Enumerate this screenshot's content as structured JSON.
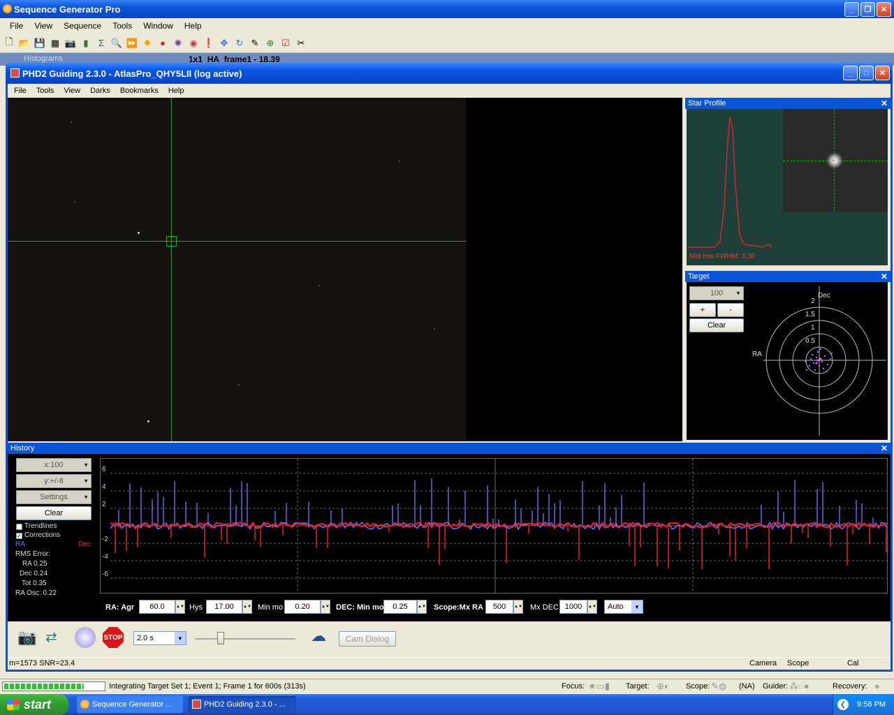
{
  "sgp": {
    "title": "Sequence Generator Pro",
    "menu": [
      "File",
      "View",
      "Sequence",
      "Tools",
      "Window",
      "Help"
    ],
    "behind_tab": "Histograms",
    "behind_doc": "1x1_HA_frame1 - 18.39"
  },
  "phd": {
    "title": "PHD2 Guiding 2.3.0 - AtlasPro_QHY5LII (log active)",
    "menu": [
      "File",
      "Tools",
      "View",
      "Darks",
      "Bookmarks",
      "Help"
    ],
    "star_profile": {
      "title": "Star Profile",
      "fwhm_label": "Mid row  FWHM: 3.30"
    },
    "target": {
      "title": "Target",
      "scale": "100",
      "plus": "+",
      "minus": "-",
      "clear": "Clear",
      "ra_label": "RA",
      "dec_label": "Dec",
      "rings": [
        "2",
        "1.5",
        "1",
        "0.5"
      ]
    },
    "history": {
      "title": "History",
      "x_scale": "x:100",
      "y_scale": "y:+/-8",
      "settings": "Settings",
      "clear": "Clear",
      "trendlines": "Trendlines",
      "corrections": "Corrections",
      "ra": "RA",
      "dec": "Dec",
      "rms_error": "RMS Error:",
      "rms_ra": "RA 0.25",
      "rms_dec": "Dec 0.24",
      "rms_tot": "Tot 0.35",
      "ra_osc": "RA Osc: 0.22",
      "y_ticks": [
        "6",
        "4",
        "2",
        "-2",
        "-4",
        "-6"
      ]
    },
    "params": {
      "ra_agr_label": "RA: Agr",
      "ra_agr": "60.0",
      "hys_label": "Hys",
      "hys": "17.00",
      "minmo_label": "Min mo",
      "minmo": "0.20",
      "dec_minmo_label": "DEC: Min mo",
      "dec_minmo": "0.25",
      "mxra_label": "Scope:Mx RA",
      "mxra": "500",
      "mxdec_label": "Mx DEC",
      "mxdec": "1000",
      "dec_mode": "Auto"
    },
    "toolbar": {
      "exposure": "2.0 s",
      "cam_dialog": "Cam Dialog",
      "stop": "STOP"
    },
    "status": {
      "left": "m=1573 SNR=23.4",
      "camera": "Camera",
      "scope": "Scope",
      "cal": "Cal"
    }
  },
  "sgp_status": {
    "progress": 0.8,
    "message": "Integrating Target Set 1; Event 1; Frame 1 for 600s (313s)",
    "focus": "Focus:",
    "target": "Target:",
    "scope": "Scope:",
    "scope_val": "(NA)",
    "guider": "Guider:",
    "recovery": "Recovery:"
  },
  "taskbar": {
    "start": "start",
    "items": [
      "Sequence Generator ...",
      "PHD2 Guiding 2.3.0 - ..."
    ],
    "clock": "9:58 PM"
  },
  "colors": {
    "ra": "#6c6cff",
    "dec": "#ff2020",
    "title_blue": "#0a54d8",
    "crosshair": "#00c000"
  }
}
